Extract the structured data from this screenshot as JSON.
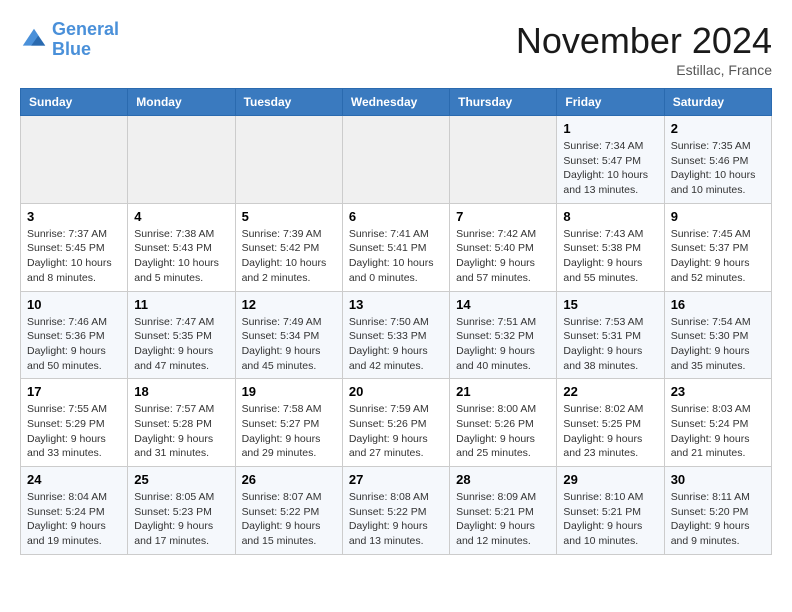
{
  "header": {
    "logo_line1": "General",
    "logo_line2": "Blue",
    "month": "November 2024",
    "location": "Estillac, France"
  },
  "weekdays": [
    "Sunday",
    "Monday",
    "Tuesday",
    "Wednesday",
    "Thursday",
    "Friday",
    "Saturday"
  ],
  "weeks": [
    [
      {
        "day": "",
        "info": ""
      },
      {
        "day": "",
        "info": ""
      },
      {
        "day": "",
        "info": ""
      },
      {
        "day": "",
        "info": ""
      },
      {
        "day": "",
        "info": ""
      },
      {
        "day": "1",
        "info": "Sunrise: 7:34 AM\nSunset: 5:47 PM\nDaylight: 10 hours and 13 minutes."
      },
      {
        "day": "2",
        "info": "Sunrise: 7:35 AM\nSunset: 5:46 PM\nDaylight: 10 hours and 10 minutes."
      }
    ],
    [
      {
        "day": "3",
        "info": "Sunrise: 7:37 AM\nSunset: 5:45 PM\nDaylight: 10 hours and 8 minutes."
      },
      {
        "day": "4",
        "info": "Sunrise: 7:38 AM\nSunset: 5:43 PM\nDaylight: 10 hours and 5 minutes."
      },
      {
        "day": "5",
        "info": "Sunrise: 7:39 AM\nSunset: 5:42 PM\nDaylight: 10 hours and 2 minutes."
      },
      {
        "day": "6",
        "info": "Sunrise: 7:41 AM\nSunset: 5:41 PM\nDaylight: 10 hours and 0 minutes."
      },
      {
        "day": "7",
        "info": "Sunrise: 7:42 AM\nSunset: 5:40 PM\nDaylight: 9 hours and 57 minutes."
      },
      {
        "day": "8",
        "info": "Sunrise: 7:43 AM\nSunset: 5:38 PM\nDaylight: 9 hours and 55 minutes."
      },
      {
        "day": "9",
        "info": "Sunrise: 7:45 AM\nSunset: 5:37 PM\nDaylight: 9 hours and 52 minutes."
      }
    ],
    [
      {
        "day": "10",
        "info": "Sunrise: 7:46 AM\nSunset: 5:36 PM\nDaylight: 9 hours and 50 minutes."
      },
      {
        "day": "11",
        "info": "Sunrise: 7:47 AM\nSunset: 5:35 PM\nDaylight: 9 hours and 47 minutes."
      },
      {
        "day": "12",
        "info": "Sunrise: 7:49 AM\nSunset: 5:34 PM\nDaylight: 9 hours and 45 minutes."
      },
      {
        "day": "13",
        "info": "Sunrise: 7:50 AM\nSunset: 5:33 PM\nDaylight: 9 hours and 42 minutes."
      },
      {
        "day": "14",
        "info": "Sunrise: 7:51 AM\nSunset: 5:32 PM\nDaylight: 9 hours and 40 minutes."
      },
      {
        "day": "15",
        "info": "Sunrise: 7:53 AM\nSunset: 5:31 PM\nDaylight: 9 hours and 38 minutes."
      },
      {
        "day": "16",
        "info": "Sunrise: 7:54 AM\nSunset: 5:30 PM\nDaylight: 9 hours and 35 minutes."
      }
    ],
    [
      {
        "day": "17",
        "info": "Sunrise: 7:55 AM\nSunset: 5:29 PM\nDaylight: 9 hours and 33 minutes."
      },
      {
        "day": "18",
        "info": "Sunrise: 7:57 AM\nSunset: 5:28 PM\nDaylight: 9 hours and 31 minutes."
      },
      {
        "day": "19",
        "info": "Sunrise: 7:58 AM\nSunset: 5:27 PM\nDaylight: 9 hours and 29 minutes."
      },
      {
        "day": "20",
        "info": "Sunrise: 7:59 AM\nSunset: 5:26 PM\nDaylight: 9 hours and 27 minutes."
      },
      {
        "day": "21",
        "info": "Sunrise: 8:00 AM\nSunset: 5:26 PM\nDaylight: 9 hours and 25 minutes."
      },
      {
        "day": "22",
        "info": "Sunrise: 8:02 AM\nSunset: 5:25 PM\nDaylight: 9 hours and 23 minutes."
      },
      {
        "day": "23",
        "info": "Sunrise: 8:03 AM\nSunset: 5:24 PM\nDaylight: 9 hours and 21 minutes."
      }
    ],
    [
      {
        "day": "24",
        "info": "Sunrise: 8:04 AM\nSunset: 5:24 PM\nDaylight: 9 hours and 19 minutes."
      },
      {
        "day": "25",
        "info": "Sunrise: 8:05 AM\nSunset: 5:23 PM\nDaylight: 9 hours and 17 minutes."
      },
      {
        "day": "26",
        "info": "Sunrise: 8:07 AM\nSunset: 5:22 PM\nDaylight: 9 hours and 15 minutes."
      },
      {
        "day": "27",
        "info": "Sunrise: 8:08 AM\nSunset: 5:22 PM\nDaylight: 9 hours and 13 minutes."
      },
      {
        "day": "28",
        "info": "Sunrise: 8:09 AM\nSunset: 5:21 PM\nDaylight: 9 hours and 12 minutes."
      },
      {
        "day": "29",
        "info": "Sunrise: 8:10 AM\nSunset: 5:21 PM\nDaylight: 9 hours and 10 minutes."
      },
      {
        "day": "30",
        "info": "Sunrise: 8:11 AM\nSunset: 5:20 PM\nDaylight: 9 hours and 9 minutes."
      }
    ]
  ]
}
